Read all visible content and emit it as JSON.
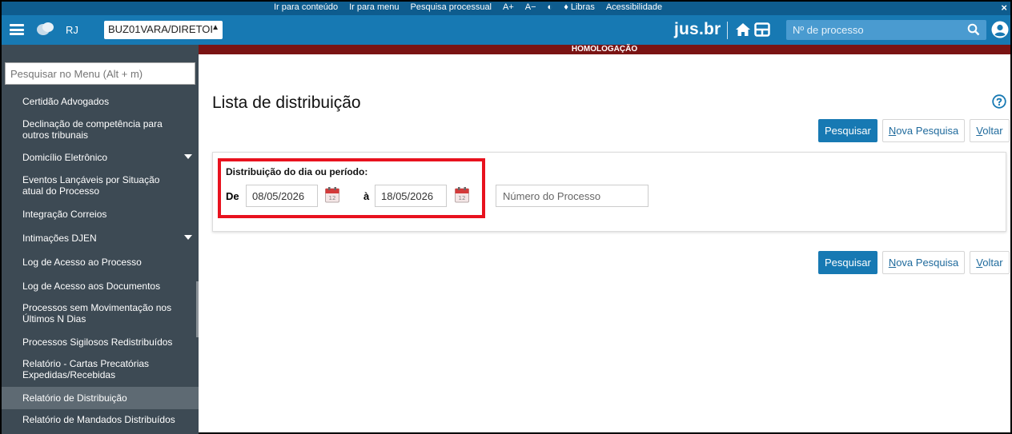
{
  "accessibility_bar": {
    "links": [
      "Ir para conteúdo",
      "Ir para menu",
      "Pesquisa processual",
      "A+",
      "A−",
      "◐",
      "♦ Libras",
      "Acessibilidade"
    ],
    "close": "×"
  },
  "header": {
    "uf": "RJ",
    "org_select": "BUZ01VARA/DIRETOI",
    "brand": "jus.br",
    "process_search_placeholder": "Nº de processo"
  },
  "homolog": "HOMOLOGAÇÃO",
  "sidebar": {
    "search_placeholder": "Pesquisar no Menu (Alt + m)",
    "items": [
      {
        "label": "Certidão Advogados",
        "expandable": false
      },
      {
        "label": "Declinação de competência para outros tribunais",
        "expandable": false
      },
      {
        "label": "Domicílio Eletrônico",
        "expandable": true
      },
      {
        "label": "Eventos Lançáveis por Situação atual do Processo",
        "expandable": false
      },
      {
        "label": "Integração Correios",
        "expandable": false
      },
      {
        "label": "Intimações DJEN",
        "expandable": true
      },
      {
        "label": "Log de Acesso ao Processo",
        "expandable": false
      },
      {
        "label": "Log de Acesso aos Documentos",
        "expandable": false
      },
      {
        "label": "Processos sem Movimentação nos Últimos N Dias",
        "expandable": false
      },
      {
        "label": "Processos Sigilosos Redistribuídos",
        "expandable": false
      },
      {
        "label": "Relatório - Cartas Precatórias Expedidas/Recebidas",
        "expandable": false
      },
      {
        "label": "Relatório de Distribuição",
        "expandable": false,
        "active": true
      },
      {
        "label": "Relatório de Mandados Distribuídos",
        "expandable": false
      }
    ]
  },
  "main": {
    "title": "Lista de distribuição",
    "buttons": {
      "search": "Pesquisar",
      "new_search": "Nova Pesquisa",
      "new_search_key": "N",
      "new_search_rest": "ova Pesquisa",
      "back": "Voltar",
      "back_key": "V",
      "back_rest": "oltar"
    },
    "filter": {
      "label": "Distribuição do dia ou período:",
      "from_label": "De",
      "from_value": "08/05/2026",
      "to_label": "à",
      "to_value": "18/05/2026",
      "process_placeholder": "Número do Processo"
    }
  },
  "colors": {
    "header_blue": "#1779b3",
    "acc_bar": "#0e5c8e",
    "sidebar": "#3d4a54",
    "homolog": "#7a1414",
    "highlight_red": "#e8121e"
  }
}
